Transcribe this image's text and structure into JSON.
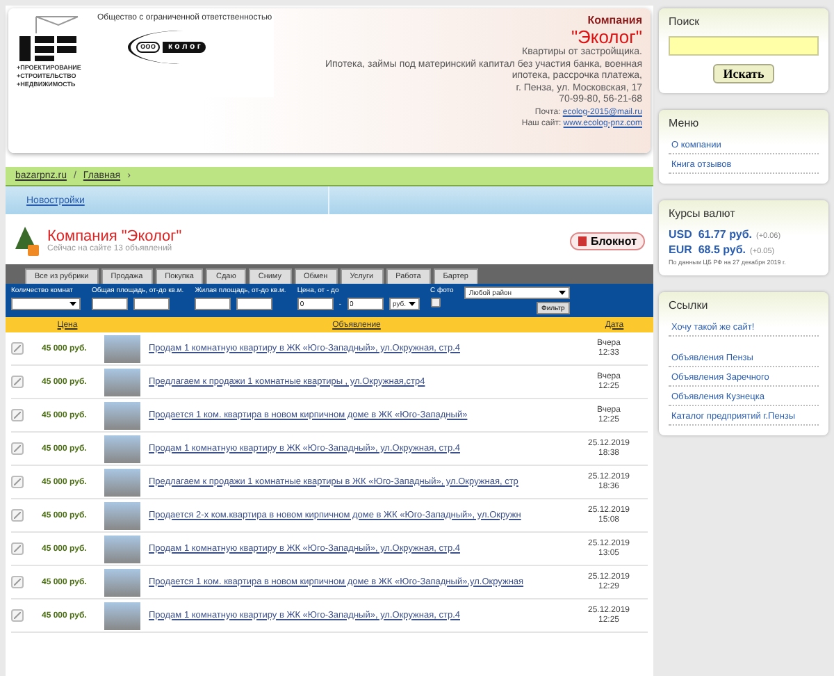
{
  "header": {
    "logo": {
      "tagline": "Общество с ограниченной ответственностью",
      "services": [
        "+ПРОЕКТИРОВАНИЕ",
        "+СТРОИТЕЛЬСТВО",
        "+НЕДВИЖИМОСТЬ"
      ],
      "badge": "ооо",
      "wordmark": "к о л о г"
    },
    "company_label": "Компания",
    "company_name": "\"Эколог\"",
    "description": [
      "Квартиры от застройщика.",
      "Ипотека, займы под материнский капитал без участия банка, военная",
      "ипотека, рассрочка платежа,",
      "г. Пенза, ул. Московская, 17",
      "70-99-80, 56-21-68"
    ],
    "email_label": "Почта:",
    "email": "ecolog-2015@mail.ru",
    "site_label": "Наш сайт:",
    "site": "www.ecolog-pnz.com"
  },
  "breadcrumbs": [
    {
      "label": "bazarpnz.ru",
      "kind": "link"
    },
    {
      "label": "/",
      "kind": "sep"
    },
    {
      "label": "Главная",
      "kind": "link"
    },
    {
      "label": "›",
      "kind": "sep"
    }
  ],
  "category_bar": {
    "label": "Новостройки"
  },
  "company": {
    "title": "Компания \"Эколог\"",
    "subtitle": "Сейчас на сайте 13 объявлений",
    "notebook_button": "Блокнот"
  },
  "tabs": [
    {
      "label": "Все из рубрики",
      "selected": false
    },
    {
      "label": "Продажа",
      "selected": false
    },
    {
      "label": "Покупка",
      "selected": false
    },
    {
      "label": "Сдаю",
      "selected": false
    },
    {
      "label": "Сниму",
      "selected": false
    },
    {
      "label": "Обмен",
      "selected": false
    },
    {
      "label": "Услуги",
      "selected": false
    },
    {
      "label": "Работа",
      "selected": false
    },
    {
      "label": "Бартер",
      "selected": false
    }
  ],
  "filters": {
    "rooms_label": "Количество комнат",
    "total_area_label": "Общая площадь, от-до кв.м.",
    "living_area_label": "Жилая площадь, от-до кв.м.",
    "price_label": "Цена, от - до",
    "price_from": "0",
    "price_dash": "-",
    "price_to": "0",
    "currency": "руб.",
    "photo_label": "С фото",
    "photo_checked": false,
    "district": "Любой район",
    "filter_button": "Фильтр"
  },
  "table": {
    "columns": [
      "Цена",
      "Объявление",
      "Дата"
    ],
    "rows": [
      {
        "price": "45 000 руб.",
        "title": "Продам 1 комнатную квартиру в ЖК «Юго-Западный», ул.Окружная, стр.4",
        "date": [
          "Вчера",
          "12:33"
        ]
      },
      {
        "price": "45 000 руб.",
        "title": "Предлагаем к продажи 1 комнатные квартиры , ул.Окружная,стр4",
        "date": [
          "Вчера",
          "12:25"
        ]
      },
      {
        "price": "45 000 руб.",
        "title": "Продается 1 ком. квартира в новом кирпичном доме в ЖК «Юго-Западный»",
        "date": [
          "Вчера",
          "12:25"
        ]
      },
      {
        "price": "45 000 руб.",
        "title": "Продам 1 комнатную квартиру в ЖК «Юго-Западный», ул.Окружная, стр.4",
        "date": [
          "25.12.2019",
          "18:38"
        ]
      },
      {
        "price": "45 000 руб.",
        "title": "Предлагаем к продажи 1 комнатные квартиры в ЖК «Юго-Западный», ул.Окружная, стр",
        "date": [
          "25.12.2019",
          "18:36"
        ]
      },
      {
        "price": "45 000 руб.",
        "title": "Продается 2-х ком.квартира в новом кирпичном доме в ЖК «Юго-Западный», ул.Окружн",
        "date": [
          "25.12.2019",
          "15:08"
        ]
      },
      {
        "price": "45 000 руб.",
        "title": "Продам 1 комнатную квартиру в ЖК «Юго-Западный», ул.Окружная, стр.4",
        "date": [
          "25.12.2019",
          "13:05"
        ]
      },
      {
        "price": "45 000 руб.",
        "title": "Продается 1 ком. квартира в новом кирпичном доме в ЖК «Юго-Западный»,ул.Окружная",
        "date": [
          "25.12.2019",
          "12:29"
        ]
      },
      {
        "price": "45 000 руб.",
        "title": "Продам 1 комнатную квартиру в ЖК «Юго-Западный», ул.Окружная, стр.4",
        "date": [
          "25.12.2019",
          "12:25"
        ]
      }
    ]
  },
  "sidebar": {
    "search": {
      "title": "Поиск",
      "button": "Искать"
    },
    "menu": {
      "title": "Меню",
      "items": [
        "О компании",
        "Книга отзывов"
      ]
    },
    "rates": {
      "title": "Курсы валют",
      "items": [
        {
          "code": "USD",
          "value": "61.77 руб.",
          "change": "(+0.06)"
        },
        {
          "code": "EUR",
          "value": "68.5 руб.",
          "change": "(+0.05)"
        }
      ],
      "note": "По данным ЦБ РФ на 27 декабря 2019 г."
    },
    "links": {
      "title": "Ссылки",
      "featured": "Хочу такой же сайт!",
      "items": [
        "Объявления Пензы",
        "Объявления Заречного",
        "Объявления Кузнецка",
        "Каталог предприятий г.Пензы"
      ]
    }
  }
}
